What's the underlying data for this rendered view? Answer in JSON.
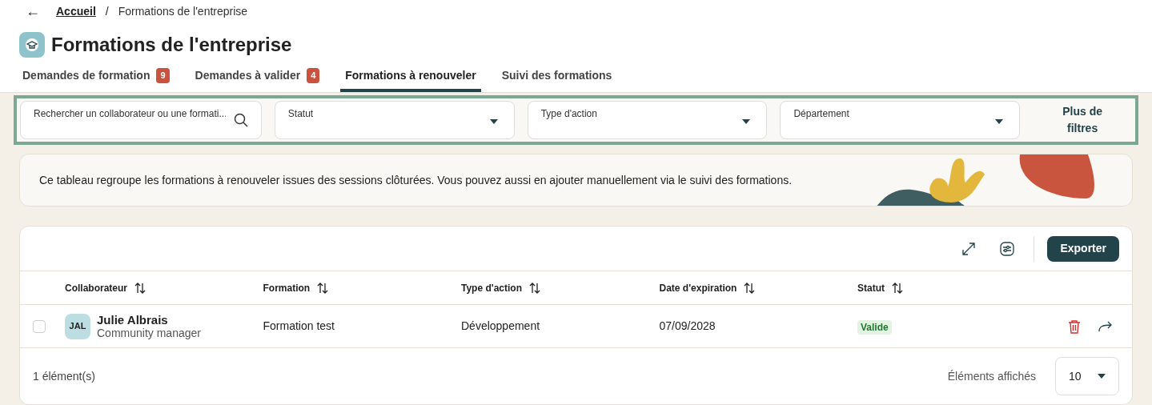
{
  "breadcrumb": {
    "back": "←",
    "link": "Accueil",
    "separator": "/",
    "current": "Formations de l'entreprise"
  },
  "title": "Formations de l'entreprise",
  "tabs": [
    {
      "label": "Demandes de formation",
      "count": "9",
      "selected": false
    },
    {
      "label": "Demandes à valider",
      "count": "4",
      "selected": false
    },
    {
      "label": "Formations à renouveler",
      "selected": true
    },
    {
      "label": "Suivi des formations",
      "selected": false
    }
  ],
  "filters": [
    {
      "kind": "search",
      "placeholder": "Rechercher un collaborateur ou une formati..."
    },
    {
      "kind": "select",
      "label": "Statut"
    },
    {
      "kind": "select",
      "label": "Type d'action"
    },
    {
      "kind": "select",
      "label": "Département"
    }
  ],
  "more_filters": "Plus de filtres",
  "banner": "Ce tableau regroupe les formations à renouveler issues des sessions clôturées. Vous pouvez aussi en ajouter manuellement via le suivi des formations.",
  "export": "Exporter",
  "table": {
    "columns": [
      "Collaborateur",
      "Formation",
      "Type d'action",
      "Date d'expiration",
      "Statut"
    ],
    "rows": [
      {
        "checked": false,
        "initials": "JAL",
        "name": "Julie Albrais",
        "role": "Community manager",
        "formation": "Formation test",
        "type": "Développement",
        "date": "07/09/2028",
        "status": "Valide"
      }
    ]
  },
  "footer": {
    "count": "1 élément(s)",
    "page_size_label": "Éléments affichés",
    "page_size": "10"
  }
}
